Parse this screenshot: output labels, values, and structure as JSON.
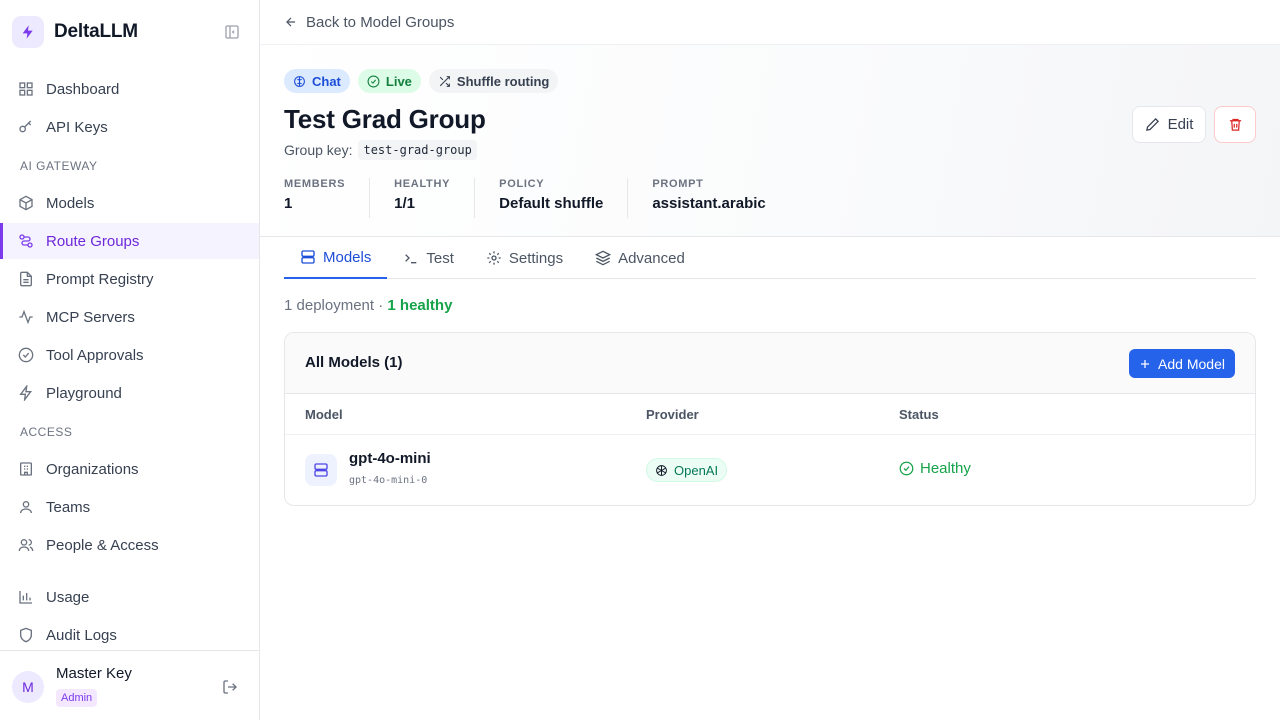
{
  "app": {
    "name": "DeltaLLM"
  },
  "sidebar": {
    "items_top": [
      {
        "label": "Dashboard",
        "icon": "dashboard-icon"
      },
      {
        "label": "API Keys",
        "icon": "key-icon"
      }
    ],
    "section_gateway": "AI GATEWAY",
    "items_gateway": [
      {
        "label": "Models",
        "icon": "cube-icon"
      },
      {
        "label": "Route Groups",
        "icon": "route-icon",
        "active": true
      },
      {
        "label": "Prompt Registry",
        "icon": "document-icon"
      },
      {
        "label": "MCP Servers",
        "icon": "activity-icon"
      },
      {
        "label": "Tool Approvals",
        "icon": "check-circle-icon"
      },
      {
        "label": "Playground",
        "icon": "lightning-icon"
      }
    ],
    "section_access": "ACCESS",
    "items_access": [
      {
        "label": "Organizations",
        "icon": "building-icon"
      },
      {
        "label": "Teams",
        "icon": "user-icon"
      },
      {
        "label": "People & Access",
        "icon": "users-icon"
      }
    ],
    "items_bottom": [
      {
        "label": "Usage",
        "icon": "bar-chart-icon"
      },
      {
        "label": "Audit Logs",
        "icon": "shield-icon"
      }
    ],
    "user": {
      "initial": "M",
      "name": "Master Key",
      "role": "Admin"
    }
  },
  "topbar": {
    "back_label": "Back to Model Groups"
  },
  "group": {
    "badges": {
      "chat": "Chat",
      "live": "Live",
      "routing": "Shuffle routing"
    },
    "title": "Test Grad Group",
    "key_label": "Group key:",
    "key_value": "test-grad-group",
    "stats": [
      {
        "label": "MEMBERS",
        "value": "1"
      },
      {
        "label": "HEALTHY",
        "value": "1/1"
      },
      {
        "label": "POLICY",
        "value": "Default shuffle"
      },
      {
        "label": "PROMPT",
        "value": "assistant.arabic"
      }
    ],
    "edit_label": "Edit"
  },
  "tabs": [
    {
      "label": "Models",
      "active": true
    },
    {
      "label": "Test"
    },
    {
      "label": "Settings"
    },
    {
      "label": "Advanced"
    }
  ],
  "summary": {
    "deployments": "1 deployment ·",
    "healthy": "1 healthy"
  },
  "models_card": {
    "title": "All Models (1)",
    "add_label": "Add Model",
    "columns": {
      "model": "Model",
      "provider": "Provider",
      "status": "Status"
    },
    "rows": [
      {
        "name": "gpt-4o-mini",
        "id": "gpt-4o-mini-0",
        "provider": "OpenAI",
        "status": "Healthy"
      }
    ]
  },
  "colors": {
    "accent": "#7c3aed",
    "primary": "#2563eb",
    "healthy": "#16a34a",
    "danger": "#dc2626"
  }
}
